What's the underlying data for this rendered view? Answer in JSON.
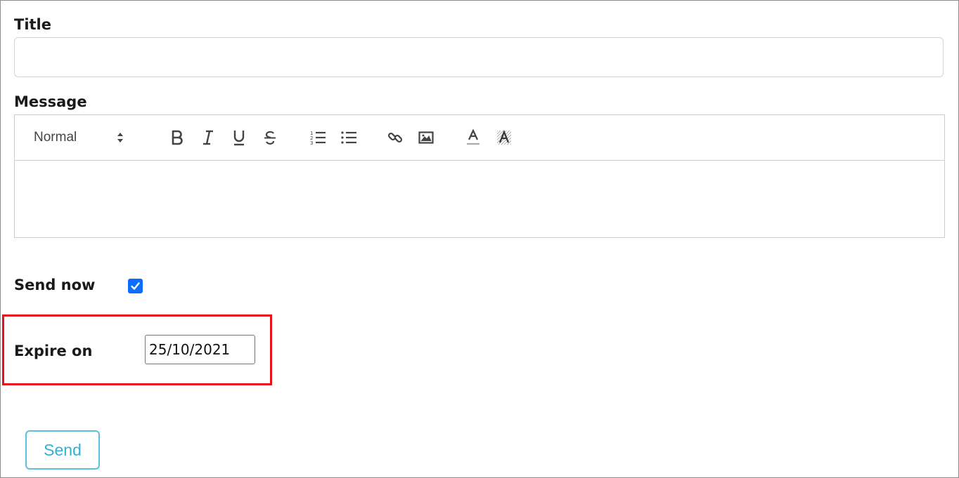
{
  "form": {
    "title_label": "Title",
    "title_value": "",
    "message_label": "Message",
    "message_value": "",
    "send_now_label": "Send now",
    "send_now_checked": true,
    "expire_label": "Expire on",
    "expire_value": "25/10/2021",
    "send_button_label": "Send"
  },
  "toolbar": {
    "format_value": "Normal",
    "buttons": [
      "bold-icon",
      "italic-icon",
      "underline-icon",
      "strikethrough-icon",
      "ordered-list-icon",
      "bullet-list-icon",
      "link-icon",
      "image-icon",
      "text-color-icon",
      "background-color-icon"
    ]
  },
  "colors": {
    "accent_checkbox": "#0d6efd",
    "highlight_border": "#e3141b",
    "send_button": "#5bc0de"
  }
}
